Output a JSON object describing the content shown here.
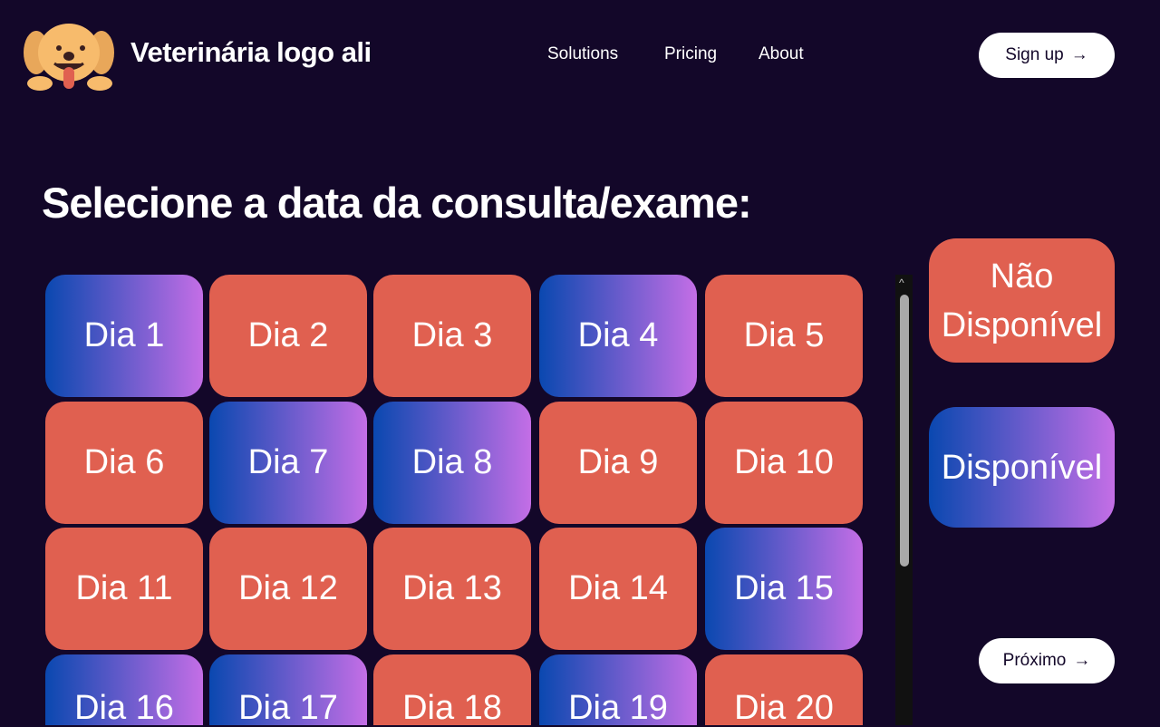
{
  "header": {
    "brand": "Veterinária logo ali",
    "nav": [
      "Solutions",
      "Pricing",
      "About"
    ],
    "signup": "Sign up"
  },
  "title": "Selecione a data da consulta/exame:",
  "days": [
    {
      "label": "Dia 1",
      "available": true
    },
    {
      "label": "Dia 2",
      "available": false
    },
    {
      "label": "Dia 3",
      "available": false
    },
    {
      "label": "Dia 4",
      "available": true
    },
    {
      "label": "Dia 5",
      "available": false
    },
    {
      "label": "Dia 6",
      "available": false
    },
    {
      "label": "Dia 7",
      "available": true
    },
    {
      "label": "Dia 8",
      "available": true
    },
    {
      "label": "Dia 9",
      "available": false
    },
    {
      "label": "Dia 10",
      "available": false
    },
    {
      "label": "Dia 11",
      "available": false
    },
    {
      "label": "Dia 12",
      "available": false
    },
    {
      "label": "Dia 13",
      "available": false
    },
    {
      "label": "Dia 14",
      "available": false
    },
    {
      "label": "Dia 15",
      "available": true
    },
    {
      "label": "Dia 16",
      "available": true
    },
    {
      "label": "Dia 17",
      "available": true
    },
    {
      "label": "Dia 18",
      "available": false
    },
    {
      "label": "Dia 19",
      "available": true
    },
    {
      "label": "Dia 20",
      "available": false
    }
  ],
  "legend": {
    "unavailable": "Não Disponível",
    "available": "Disponível"
  },
  "next": "Próximo",
  "colors": {
    "background": "#130729",
    "unavailable": "#e06050",
    "available_start": "#0a48b0",
    "available_end": "#c46ee6"
  }
}
